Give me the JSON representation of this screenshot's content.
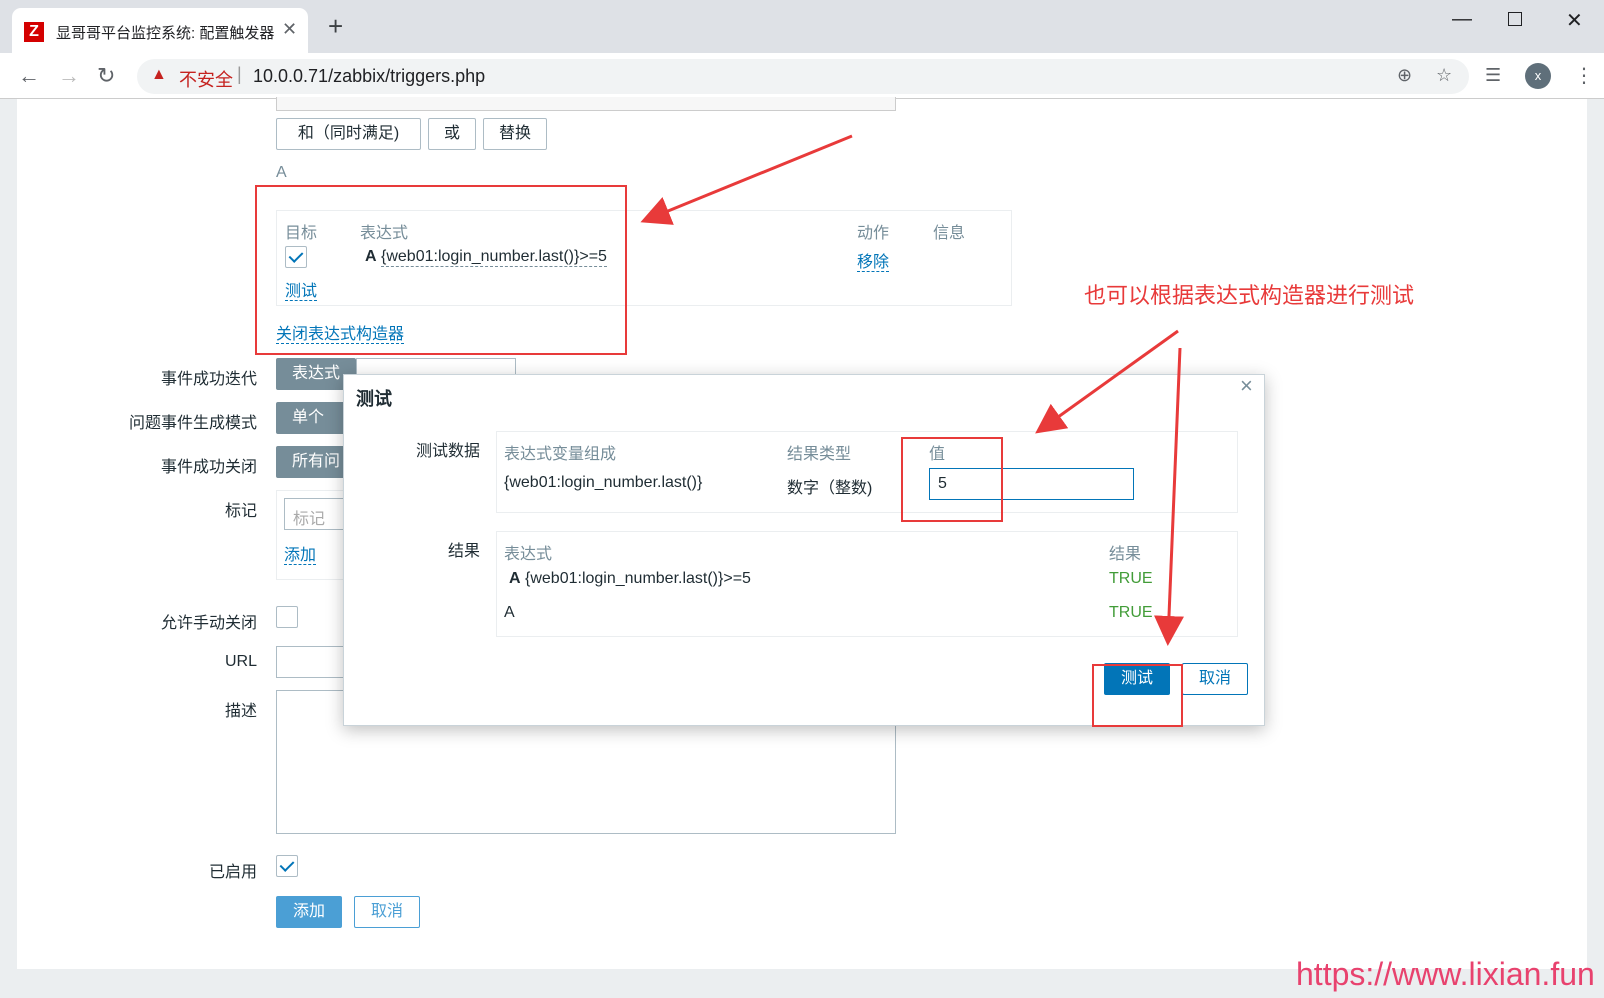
{
  "browser": {
    "tab_title": "显哥哥平台监控系统: 配置触发器",
    "favicon_letter": "Z",
    "security_label": "不安全",
    "url": "10.0.0.71/zabbix/triggers.php",
    "profile_initial": "x"
  },
  "expression_builder": {
    "logic_buttons": [
      "和（同时满足)",
      "或",
      "替换"
    ],
    "formula": "A",
    "columns": {
      "target": "目标",
      "expression": "表达式",
      "action": "动作",
      "info": "信息"
    },
    "row": {
      "label": "A",
      "expression": "{web01:login_number.last()}>=5",
      "action": "移除"
    },
    "test_link": "测试",
    "close_link": "关闭表达式构造器"
  },
  "form": {
    "ok_event_generation": {
      "label": "事件成功迭代",
      "value": "表达式"
    },
    "problem_mode": {
      "label": "问题事件生成模式",
      "value": "单个"
    },
    "ok_event_close": {
      "label": "事件成功关闭",
      "value": "所有问"
    },
    "tags": {
      "label": "标记",
      "placeholder": "标记",
      "add": "添加"
    },
    "manual_close": {
      "label": "允许手动关闭"
    },
    "url": {
      "label": "URL"
    },
    "description": {
      "label": "描述"
    },
    "enabled": {
      "label": "已启用"
    },
    "add_button": "添加",
    "cancel_button": "取消"
  },
  "dialog": {
    "title": "测试",
    "test_data_label": "测试数据",
    "test_data_columns": {
      "expr_var": "表达式变量组成",
      "result_type": "结果类型",
      "value": "值"
    },
    "test_data_row": {
      "expr_var": "{web01:login_number.last()}",
      "result_type": "数字（整数)",
      "value": "5"
    },
    "result_label": "结果",
    "result_columns": {
      "expression": "表达式",
      "result": "结果"
    },
    "result_rows": [
      {
        "label": "A",
        "expression": "{web01:login_number.last()}>=5",
        "result": "TRUE"
      },
      {
        "label": "",
        "expression": "A",
        "result": "TRUE"
      }
    ],
    "test_button": "测试",
    "cancel_button": "取消"
  },
  "annotation": {
    "callout": "也可以根据表达式构造器进行测试",
    "watermark": "https://www.lixian.fun"
  },
  "colors": {
    "accent": "#0275b8",
    "true": "#429c38",
    "annotation": "#e83a3a"
  }
}
